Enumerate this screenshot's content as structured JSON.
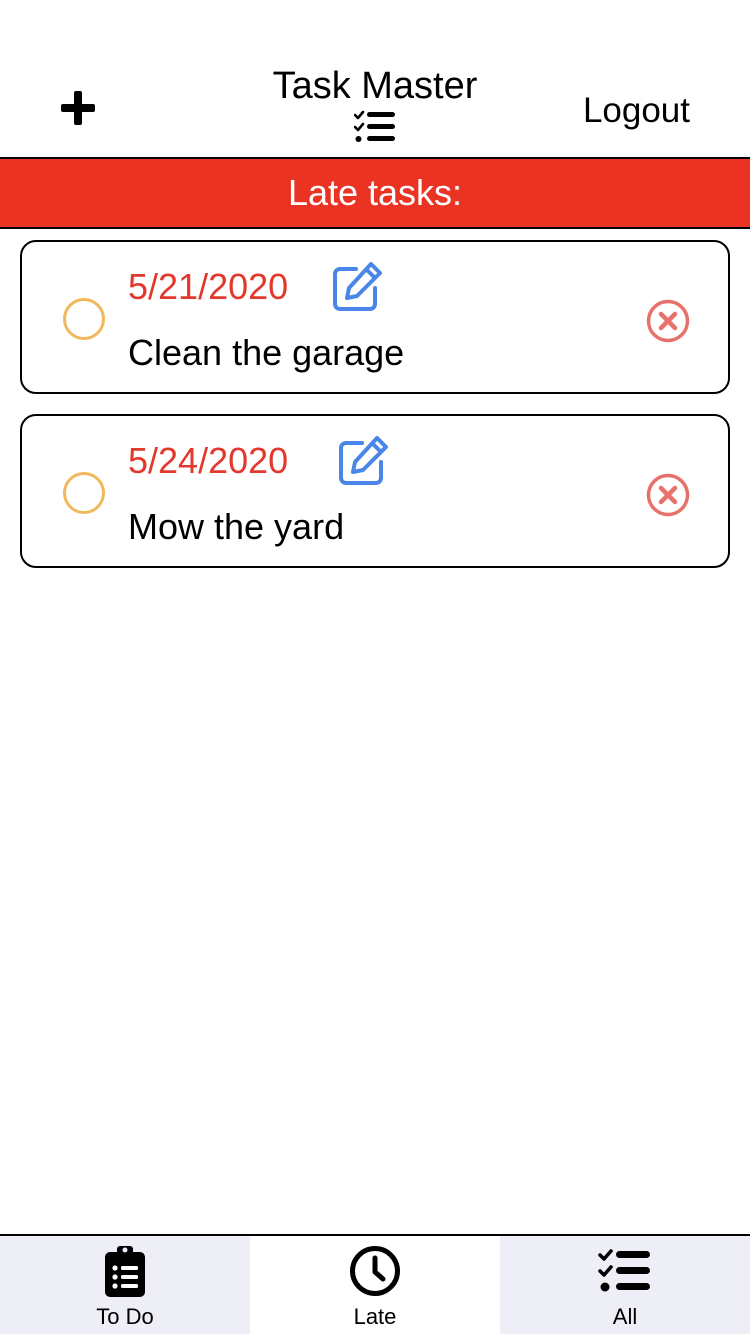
{
  "header": {
    "title": "Task Master",
    "logout_label": "Logout"
  },
  "banner": {
    "text": "Late tasks:"
  },
  "tasks": [
    {
      "date": "5/21/2020",
      "name": "Clean the garage"
    },
    {
      "date": "5/24/2020",
      "name": "Mow the yard"
    }
  ],
  "tabs": [
    {
      "label": "To Do",
      "icon": "clipboard-list-icon",
      "active": false
    },
    {
      "label": "Late",
      "icon": "clock-icon",
      "active": true
    },
    {
      "label": "All",
      "icon": "tasks-list-icon",
      "active": false
    }
  ],
  "colors": {
    "banner": "#ea3323",
    "date": "#e2392c",
    "checkbox": "#f1b85c",
    "edit": "#4a86e8",
    "delete": "#e8716b"
  }
}
